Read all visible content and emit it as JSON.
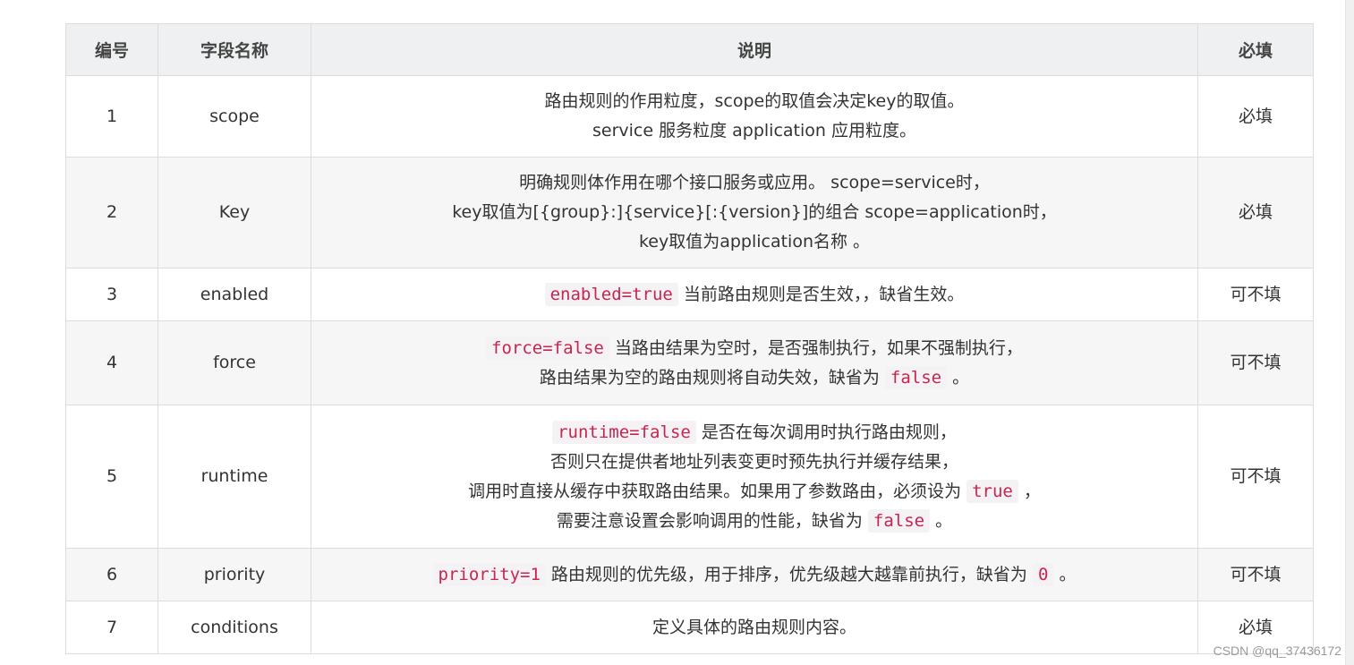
{
  "headers": {
    "no": "编号",
    "name": "字段名称",
    "desc": "说明",
    "required": "必填"
  },
  "rows": [
    {
      "no": "1",
      "name": "scope",
      "required": "必填",
      "lines": [
        [
          {
            "t": "路由规则的作用粒度，scope的取值会决定key的取值。"
          }
        ],
        [
          {
            "t": "service 服务粒度 application 应用粒度。"
          }
        ]
      ]
    },
    {
      "no": "2",
      "name": "Key",
      "required": "必填",
      "lines": [
        [
          {
            "t": "明确规则体作用在哪个接口服务或应用。 scope=service时，"
          }
        ],
        [
          {
            "t": "key取值为[{group}:]{service}[:{version}]的组合 scope=application时，"
          }
        ],
        [
          {
            "t": "key取值为application名称 。"
          }
        ]
      ]
    },
    {
      "no": "3",
      "name": "enabled",
      "required": "可不填",
      "lines": [
        [
          {
            "c": "enabled=true"
          },
          {
            "t": " 当前路由规则是否生效，，缺省生效。"
          }
        ]
      ]
    },
    {
      "no": "4",
      "name": "force",
      "required": "可不填",
      "lines": [
        [
          {
            "c": "force=false"
          },
          {
            "t": " 当路由结果为空时，是否强制执行，如果不强制执行，"
          }
        ],
        [
          {
            "t": "路由结果为空的路由规则将自动失效，缺省为 "
          },
          {
            "c": "false"
          },
          {
            "t": " 。"
          }
        ]
      ]
    },
    {
      "no": "5",
      "name": "runtime",
      "required": "可不填",
      "lines": [
        [
          {
            "c": "runtime=false"
          },
          {
            "t": " 是否在每次调用时执行路由规则，"
          }
        ],
        [
          {
            "t": "否则只在提供者地址列表变更时预先执行并缓存结果，"
          }
        ],
        [
          {
            "t": "调用时直接从缓存中获取路由结果。如果用了参数路由，必须设为 "
          },
          {
            "c": "true"
          },
          {
            "t": " ，"
          }
        ],
        [
          {
            "t": "需要注意设置会影响调用的性能，缺省为 "
          },
          {
            "c": "false"
          },
          {
            "t": " 。"
          }
        ]
      ]
    },
    {
      "no": "6",
      "name": "priority",
      "required": "可不填",
      "lines": [
        [
          {
            "c": "priority=1"
          },
          {
            "t": " 路由规则的优先级，用于排序，优先级越大越靠前执行，缺省为 "
          },
          {
            "c": "0"
          },
          {
            "t": " 。"
          }
        ]
      ]
    },
    {
      "no": "7",
      "name": "conditions",
      "required": "必填",
      "lines": [
        [
          {
            "t": "定义具体的路由规则内容。"
          }
        ]
      ]
    }
  ],
  "watermark": "CSDN @qq_37436172"
}
